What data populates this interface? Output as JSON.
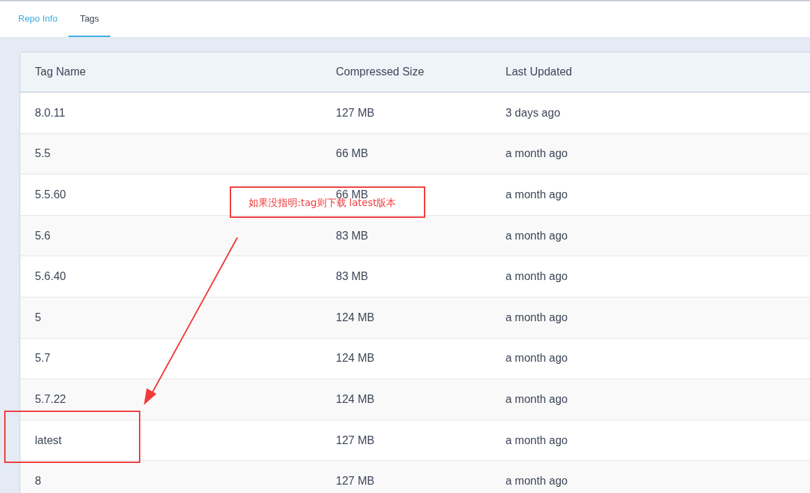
{
  "tabs": [
    {
      "label": "Repo Info",
      "selected": false
    },
    {
      "label": "Tags",
      "selected": true
    }
  ],
  "table": {
    "columns": [
      "Tag Name",
      "Compressed Size",
      "Last Updated"
    ],
    "rows": [
      [
        "8.0.11",
        "127 MB",
        "3 days ago"
      ],
      [
        "5.5",
        "66 MB",
        "a month ago"
      ],
      [
        "5.5.60",
        "66 MB",
        "a month ago"
      ],
      [
        "5.6",
        "83 MB",
        "a month ago"
      ],
      [
        "5.6.40",
        "83 MB",
        "a month ago"
      ],
      [
        "5",
        "124 MB",
        "a month ago"
      ],
      [
        "5.7",
        "124 MB",
        "a month ago"
      ],
      [
        "5.7.22",
        "124 MB",
        "a month ago"
      ],
      [
        "latest",
        "127 MB",
        "a month ago"
      ],
      [
        "8",
        "127 MB",
        "a month ago"
      ]
    ]
  },
  "annotation": {
    "note": "如果没指明:tag则下载 latest版本"
  }
}
